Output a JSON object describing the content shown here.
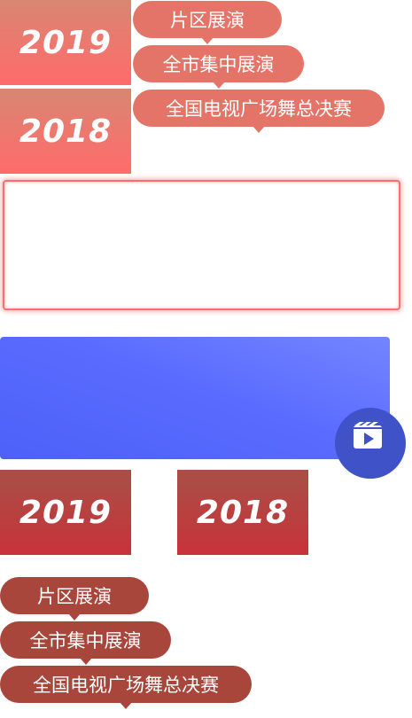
{
  "top_section": {
    "years": [
      "2019",
      "2018"
    ],
    "tags": [
      "片区展演",
      "全市集中展演",
      "全国电视广场舞总决赛"
    ]
  },
  "video_section": {
    "icon": "video-play-icon"
  },
  "bottom_section": {
    "years": [
      "2019",
      "2018"
    ],
    "tags": [
      "片区展演",
      "全市集中展演",
      "全国电视广场舞总决赛"
    ]
  },
  "colors": {
    "salmon": "#e47468",
    "maroon": "#a8463c",
    "frame_border": "#ff6e6e",
    "video_blue": "#5a6cff"
  }
}
